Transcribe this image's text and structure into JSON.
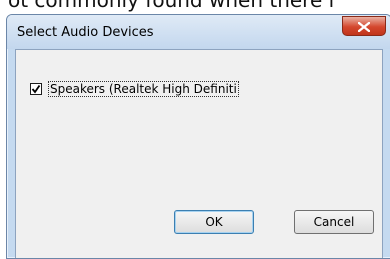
{
  "background_caption": "ot commonly found when there i",
  "window": {
    "title": "Select Audio Devices",
    "close_icon": "close-icon"
  },
  "devices": [
    {
      "label": "Speakers (Realtek High Definiti",
      "checked": true
    }
  ],
  "buttons": {
    "ok_label": "OK",
    "cancel_label": "Cancel"
  },
  "colors": {
    "close_button": "#d4472e",
    "title_bar": "#c3d7ee",
    "client_bg": "#f0f0f0"
  }
}
